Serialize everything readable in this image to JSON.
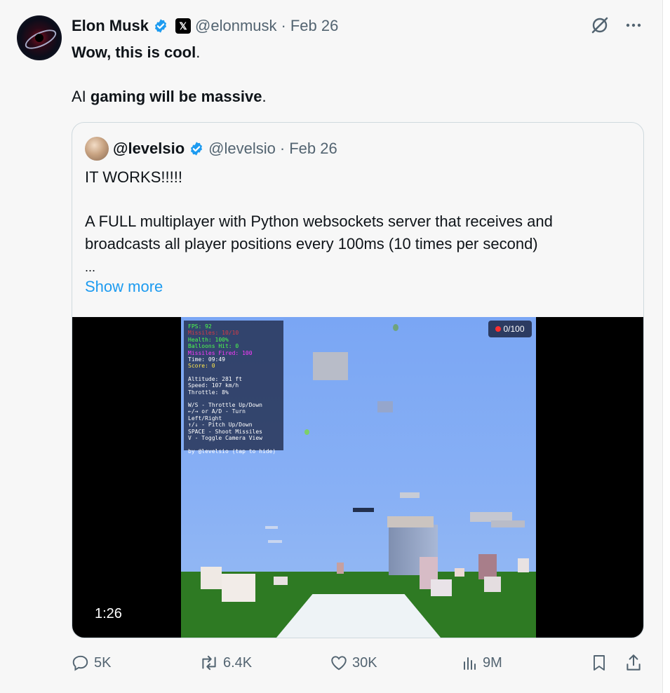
{
  "tweet": {
    "author_name": "Elon Musk",
    "x_badge": "𝕏",
    "handle": "@elonmusk",
    "separator": "·",
    "date": "Feb 26",
    "line1": "Wow, this is cool",
    "line1_end": ".",
    "line2_pre": "AI ",
    "line2_bold": "gaming will be massive",
    "line2_end": "."
  },
  "quote": {
    "display_name": "@levelsio",
    "handle": "@levelsio",
    "separator": "·",
    "date": "Feb 26",
    "line1": "IT WORKS!!!!!",
    "line2": "A FULL multiplayer with Python websockets server that receives and",
    "line3": "broadcasts all player positions every 100ms (10 times per second)",
    "ellipsis": "...",
    "show_more": "Show more"
  },
  "video": {
    "duration": "1:26",
    "counter": "0/100",
    "hud": {
      "fps": "FPS: 92",
      "hidden_red": "Missiles: 10/10",
      "health": "Health: 100%",
      "balloons": "Balloons Hit: 0",
      "hidden_magenta": "Missiles Fired: 100",
      "time": "Time: 09:49",
      "score": "Score: 0",
      "altitude": "Altitude: 281 ft",
      "speed": "Speed: 107 km/h",
      "throttle": "Throttle: 8%",
      "c1": "W/S - Throttle Up/Down",
      "c2": "←/→ or A/D - Turn Left/Right",
      "c3": "↑/↓ - Pitch Up/Down",
      "c4": "SPACE - Shoot Missiles",
      "c5": "V - Toggle Camera View",
      "credit": "by @levelsio (tap to hide)"
    }
  },
  "actions": {
    "replies": "5K",
    "reposts": "6.4K",
    "likes": "30K",
    "views": "9M"
  },
  "colors": {
    "verified": "#1d9bf0",
    "link": "#1d9bf0",
    "muted": "#536471"
  },
  "icons": [
    "grok-icon",
    "more-icon",
    "verified-icon",
    "x-logo-icon",
    "reply-icon",
    "repost-icon",
    "like-icon",
    "views-icon",
    "bookmark-icon",
    "share-icon"
  ]
}
